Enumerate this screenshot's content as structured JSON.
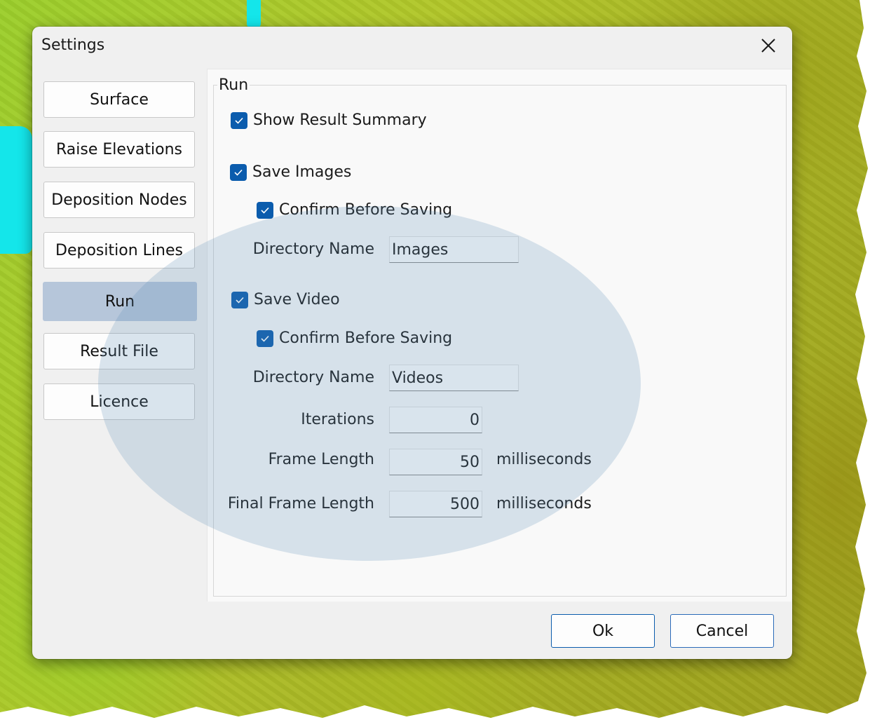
{
  "window": {
    "title": "Settings",
    "close_icon": "close-icon"
  },
  "sidebar": {
    "items": [
      {
        "label": "Surface",
        "selected": false
      },
      {
        "label": "Raise Elevations",
        "selected": false
      },
      {
        "label": "Deposition Nodes",
        "selected": false
      },
      {
        "label": "Deposition Lines",
        "selected": false
      },
      {
        "label": "Run",
        "selected": true
      },
      {
        "label": "Result File",
        "selected": false
      },
      {
        "label": "Licence",
        "selected": false
      }
    ]
  },
  "run": {
    "group_title": "Run",
    "show_result_summary": {
      "label": "Show Result Summary",
      "checked": true
    },
    "save_images": {
      "label": "Save Images",
      "checked": true
    },
    "images_confirm": {
      "label": "Confirm Before Saving",
      "checked": true
    },
    "images_directory": {
      "label": "Directory Name",
      "value": "Images"
    },
    "save_video": {
      "label": "Save Video",
      "checked": true
    },
    "video_confirm": {
      "label": "Confirm Before Saving",
      "checked": true
    },
    "video_directory": {
      "label": "Directory Name",
      "value": "Videos"
    },
    "iterations": {
      "label": "Iterations",
      "value": "0"
    },
    "frame_length": {
      "label": "Frame Length",
      "value": "50",
      "unit": "milliseconds"
    },
    "final_frame_length": {
      "label": "Final Frame Length",
      "value": "500",
      "unit": "milliseconds"
    }
  },
  "buttons": {
    "ok": "Ok",
    "cancel": "Cancel"
  },
  "colors": {
    "accent": "#0b5cad",
    "selected_nav": "#b6c6da",
    "highlight": "#5a8cb4"
  }
}
